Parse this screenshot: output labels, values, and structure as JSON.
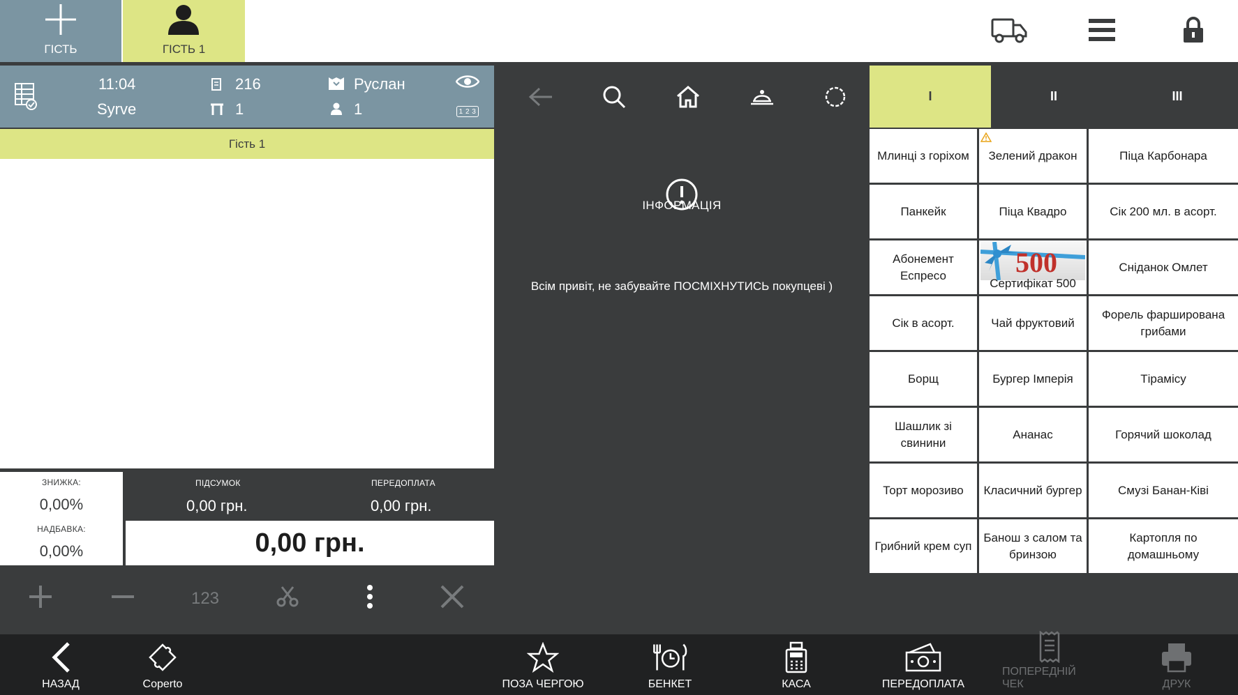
{
  "topbar": {
    "add_guest_label": "ГІСТЬ",
    "guest_tab_label": "ГІСТЬ 1"
  },
  "order": {
    "time": "11:04",
    "restaurant": "Syrve",
    "order_number": "216",
    "table": "1",
    "waiter": "Руслан",
    "guests": "1",
    "counter_badge": "1 2 3",
    "guest_section": "Гість 1"
  },
  "totals": {
    "discount_label": "ЗНИЖКА:",
    "discount_value": "0,00%",
    "surcharge_label": "НАДБАВКА:",
    "surcharge_value": "0,00%",
    "subtotal_label": "ПІДСУМОК",
    "subtotal_value": "0,00 грн.",
    "prepay_label": "ПЕРЕДОПЛАТА",
    "prepay_value": "0,00 грн.",
    "total_value": "0,00 грн."
  },
  "actions": {
    "numpad_label": "123"
  },
  "info": {
    "title": "ІНФОРМАЦІЯ",
    "message": "Всім привіт, не забувайте ПОСМІХНУТИСЬ покупцеві )"
  },
  "menu": {
    "pages": [
      "I",
      "II",
      "III"
    ],
    "active_page": "I",
    "items": [
      "Млинці з горіхом",
      "Зелений дракон",
      "Піца Карбонара",
      "Панкейк",
      "Піца Квадро",
      "Сік 200 мл. в асорт.",
      "Абонемент Еспресо",
      "Сертифікат 500",
      "Сніданок Омлет",
      "Сік в асорт.",
      "Чай фруктовий",
      "Форель фарширована грибами",
      "Борщ",
      "Бургер Імперія",
      "Тірамісу",
      "Шашлик зі свинини",
      "Ананас",
      "Горячий шоколад",
      "Торт морозиво",
      "Класичний бургер",
      "Смузі Банан-Ківі",
      "Грибний крем суп",
      "Банош з салом та бринзою",
      "Картопля по домашньому"
    ],
    "certificate_image_text": "500"
  },
  "bottombar": {
    "back": "НАЗАД",
    "coperto": "Coperto",
    "out_of_turn": "ПОЗА ЧЕРГОЮ",
    "banquet": "БЕНКЕТ",
    "cash": "КАСА",
    "prepay": "ПЕРЕДОПЛАТА",
    "pre_check": "ПОПЕРЕДНІЙ ЧЕК",
    "print": "ДРУК"
  },
  "colors": {
    "accent_yellow": "#dde585",
    "slate_blue": "#7b95a2",
    "dark_panel": "#3a3c3d",
    "bottom_bar": "#202122",
    "warning": "#e8a317"
  },
  "icons": [
    "plus-icon",
    "user-icon",
    "truck-icon",
    "hamburger-menu-icon",
    "lock-icon",
    "order-list-icon",
    "receipt-icon",
    "table-icon",
    "waiter-icon",
    "guest-icon",
    "eye-icon",
    "back-arrow-icon",
    "search-icon",
    "home-icon",
    "kitchen-icon",
    "settings-icon",
    "alert-icon",
    "warning-icon",
    "add-icon",
    "minus-icon",
    "scissors-icon",
    "more-icon",
    "close-icon",
    "chevron-left-icon",
    "puzzle-icon",
    "star-icon",
    "banquet-icon",
    "cash-register-icon",
    "money-icon",
    "check-icon",
    "printer-icon"
  ]
}
